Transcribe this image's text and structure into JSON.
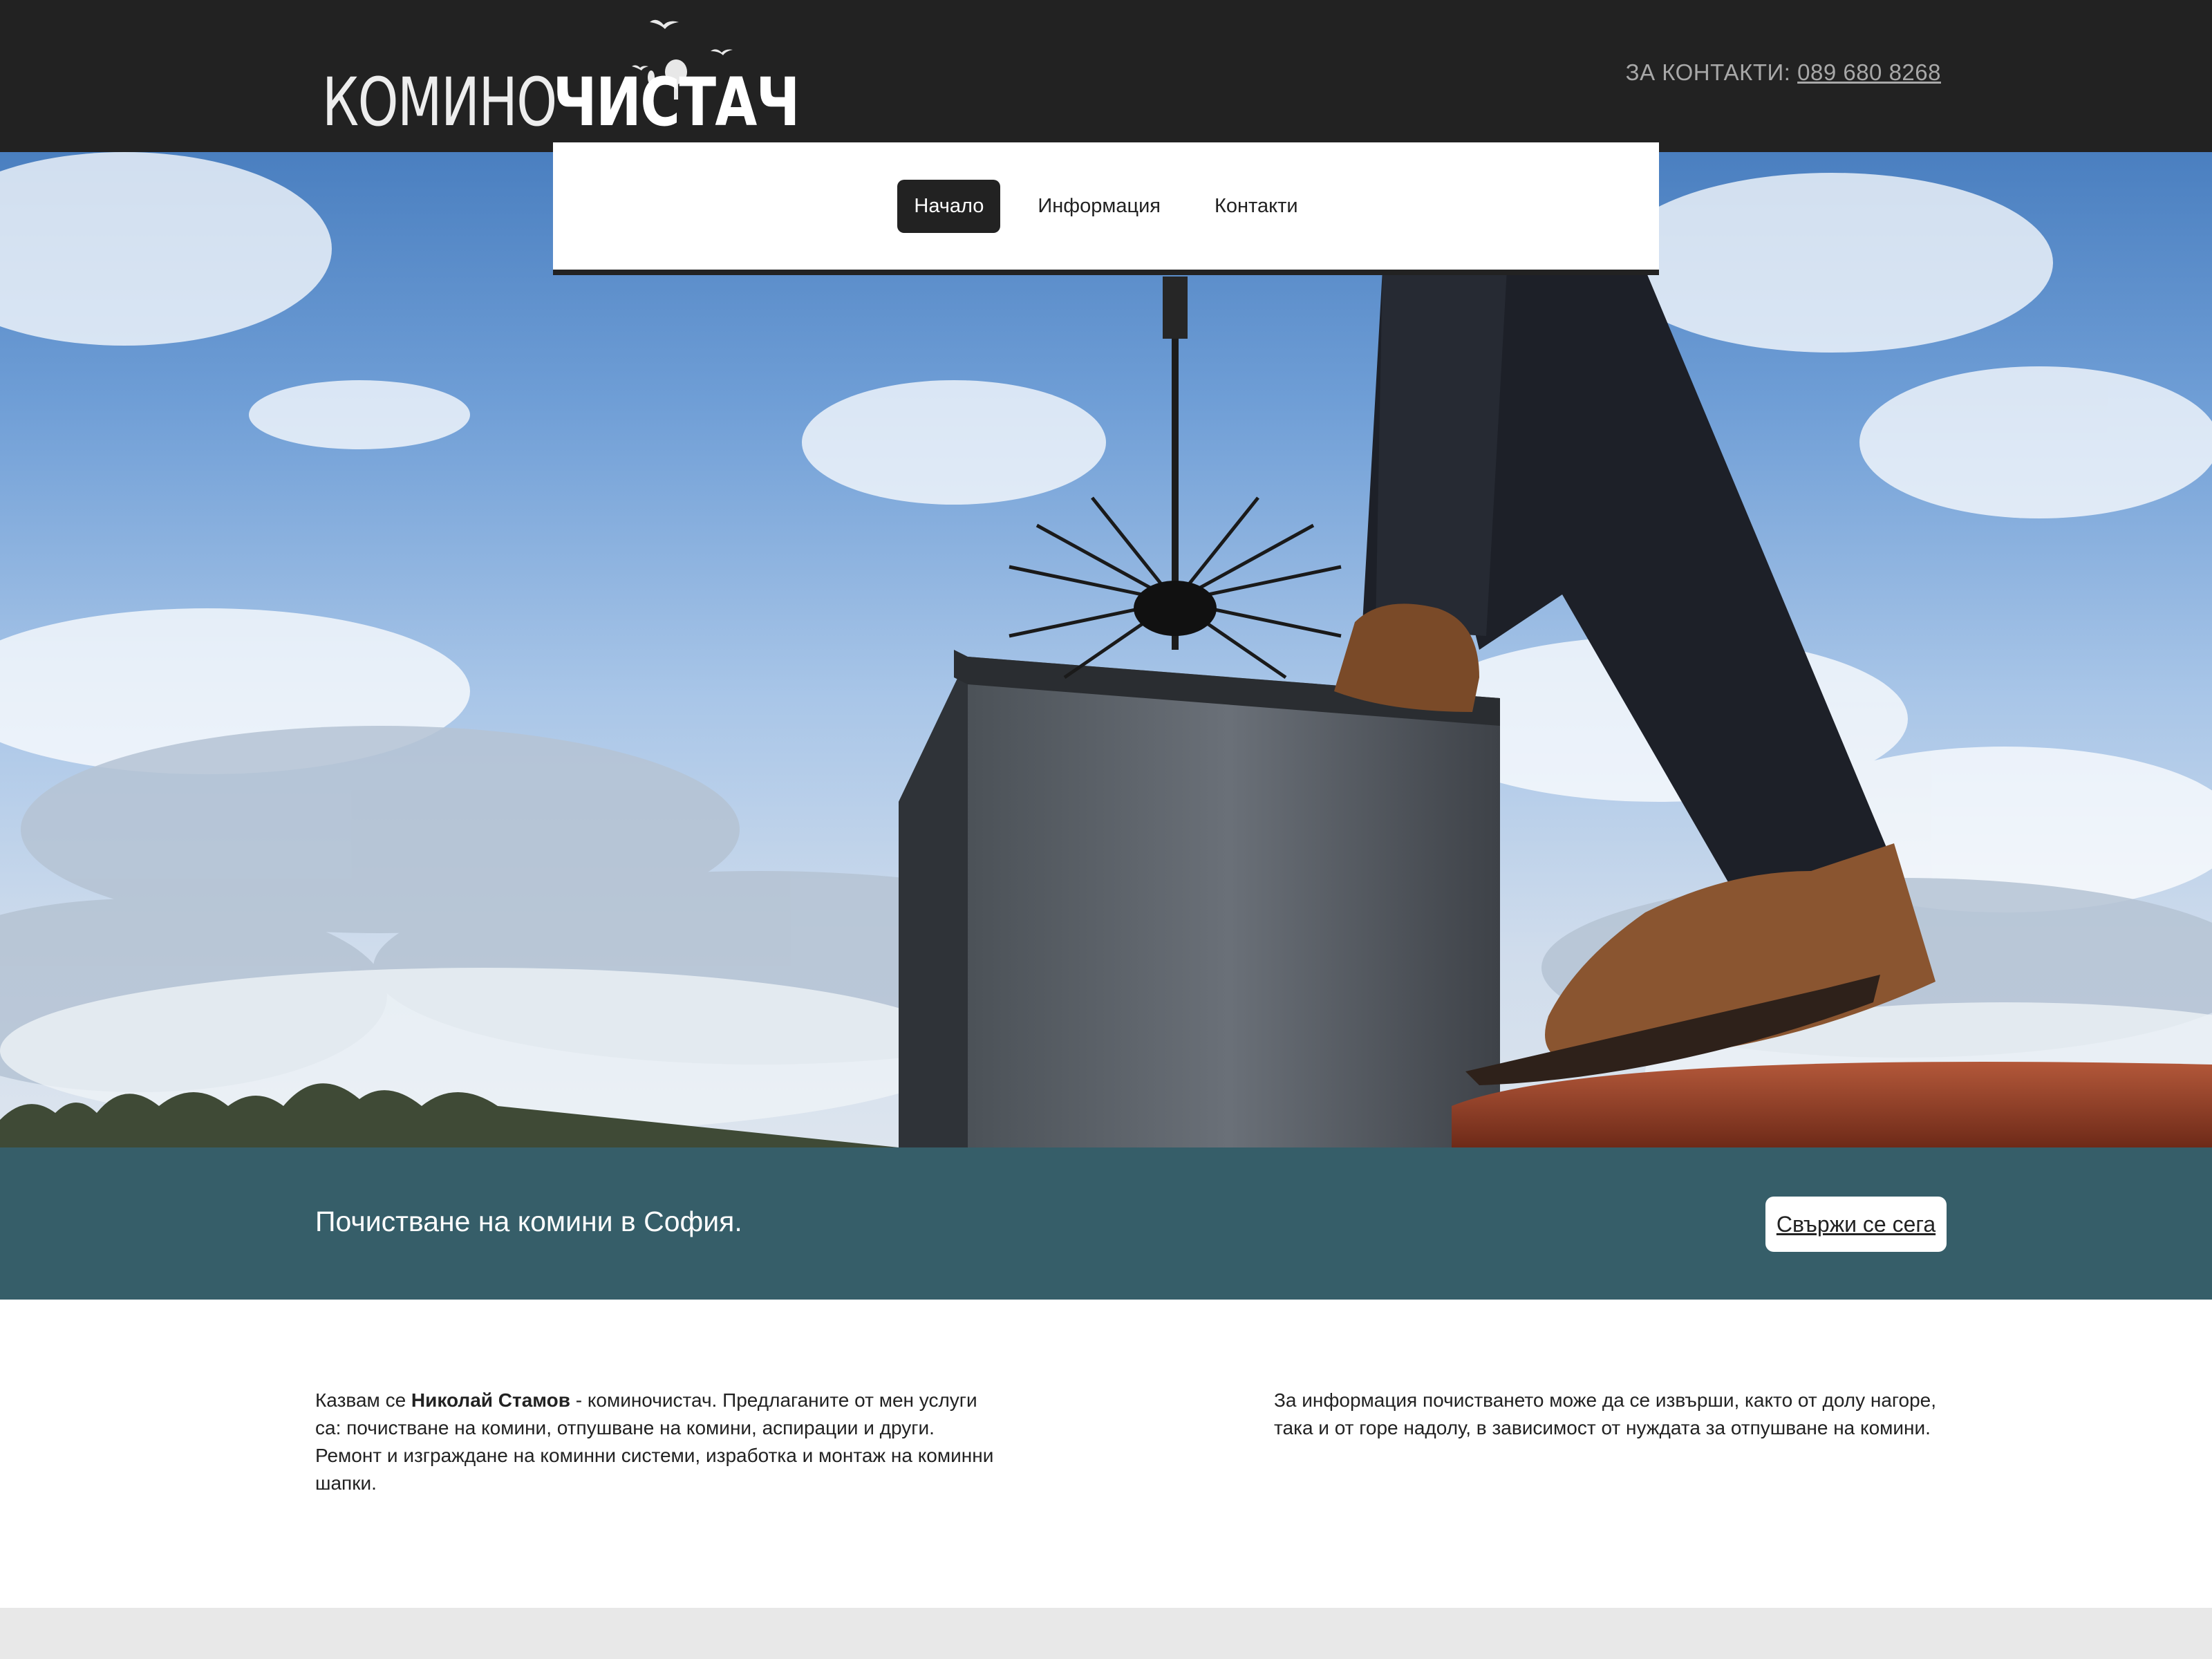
{
  "header": {
    "logo_light": "КОМИНО",
    "logo_bold": "ЧИСТАЧ",
    "contact_label": "ЗА КОНТАКТИ:",
    "contact_phone": "089 680 8268"
  },
  "nav": {
    "items": [
      {
        "label": "Начало",
        "active": true
      },
      {
        "label": "Информация",
        "active": false
      },
      {
        "label": "Контакти",
        "active": false
      }
    ]
  },
  "band": {
    "text": "Почистване на комини в София.",
    "button": "Свържи се сега"
  },
  "content": {
    "left": {
      "prefix": "Казвам се ",
      "name": "Николай Стамов",
      "suffix": " - коминочистач. Предлаганите от мен услуги са: почистване на комини, отпушване на комини, аспирации и други. Ремонт и изграждане на коминни системи, изработка и монтаж на коминни шапки."
    },
    "right": {
      "text": "За информация почистването може да се извърши, както от долу нагоре, така и от горе надолу, в зависимост от нуждата за отпушване на комини."
    }
  },
  "colors": {
    "header_bg": "#222222",
    "band_bg": "#365e69",
    "footer_bg": "#e8e8e8"
  }
}
